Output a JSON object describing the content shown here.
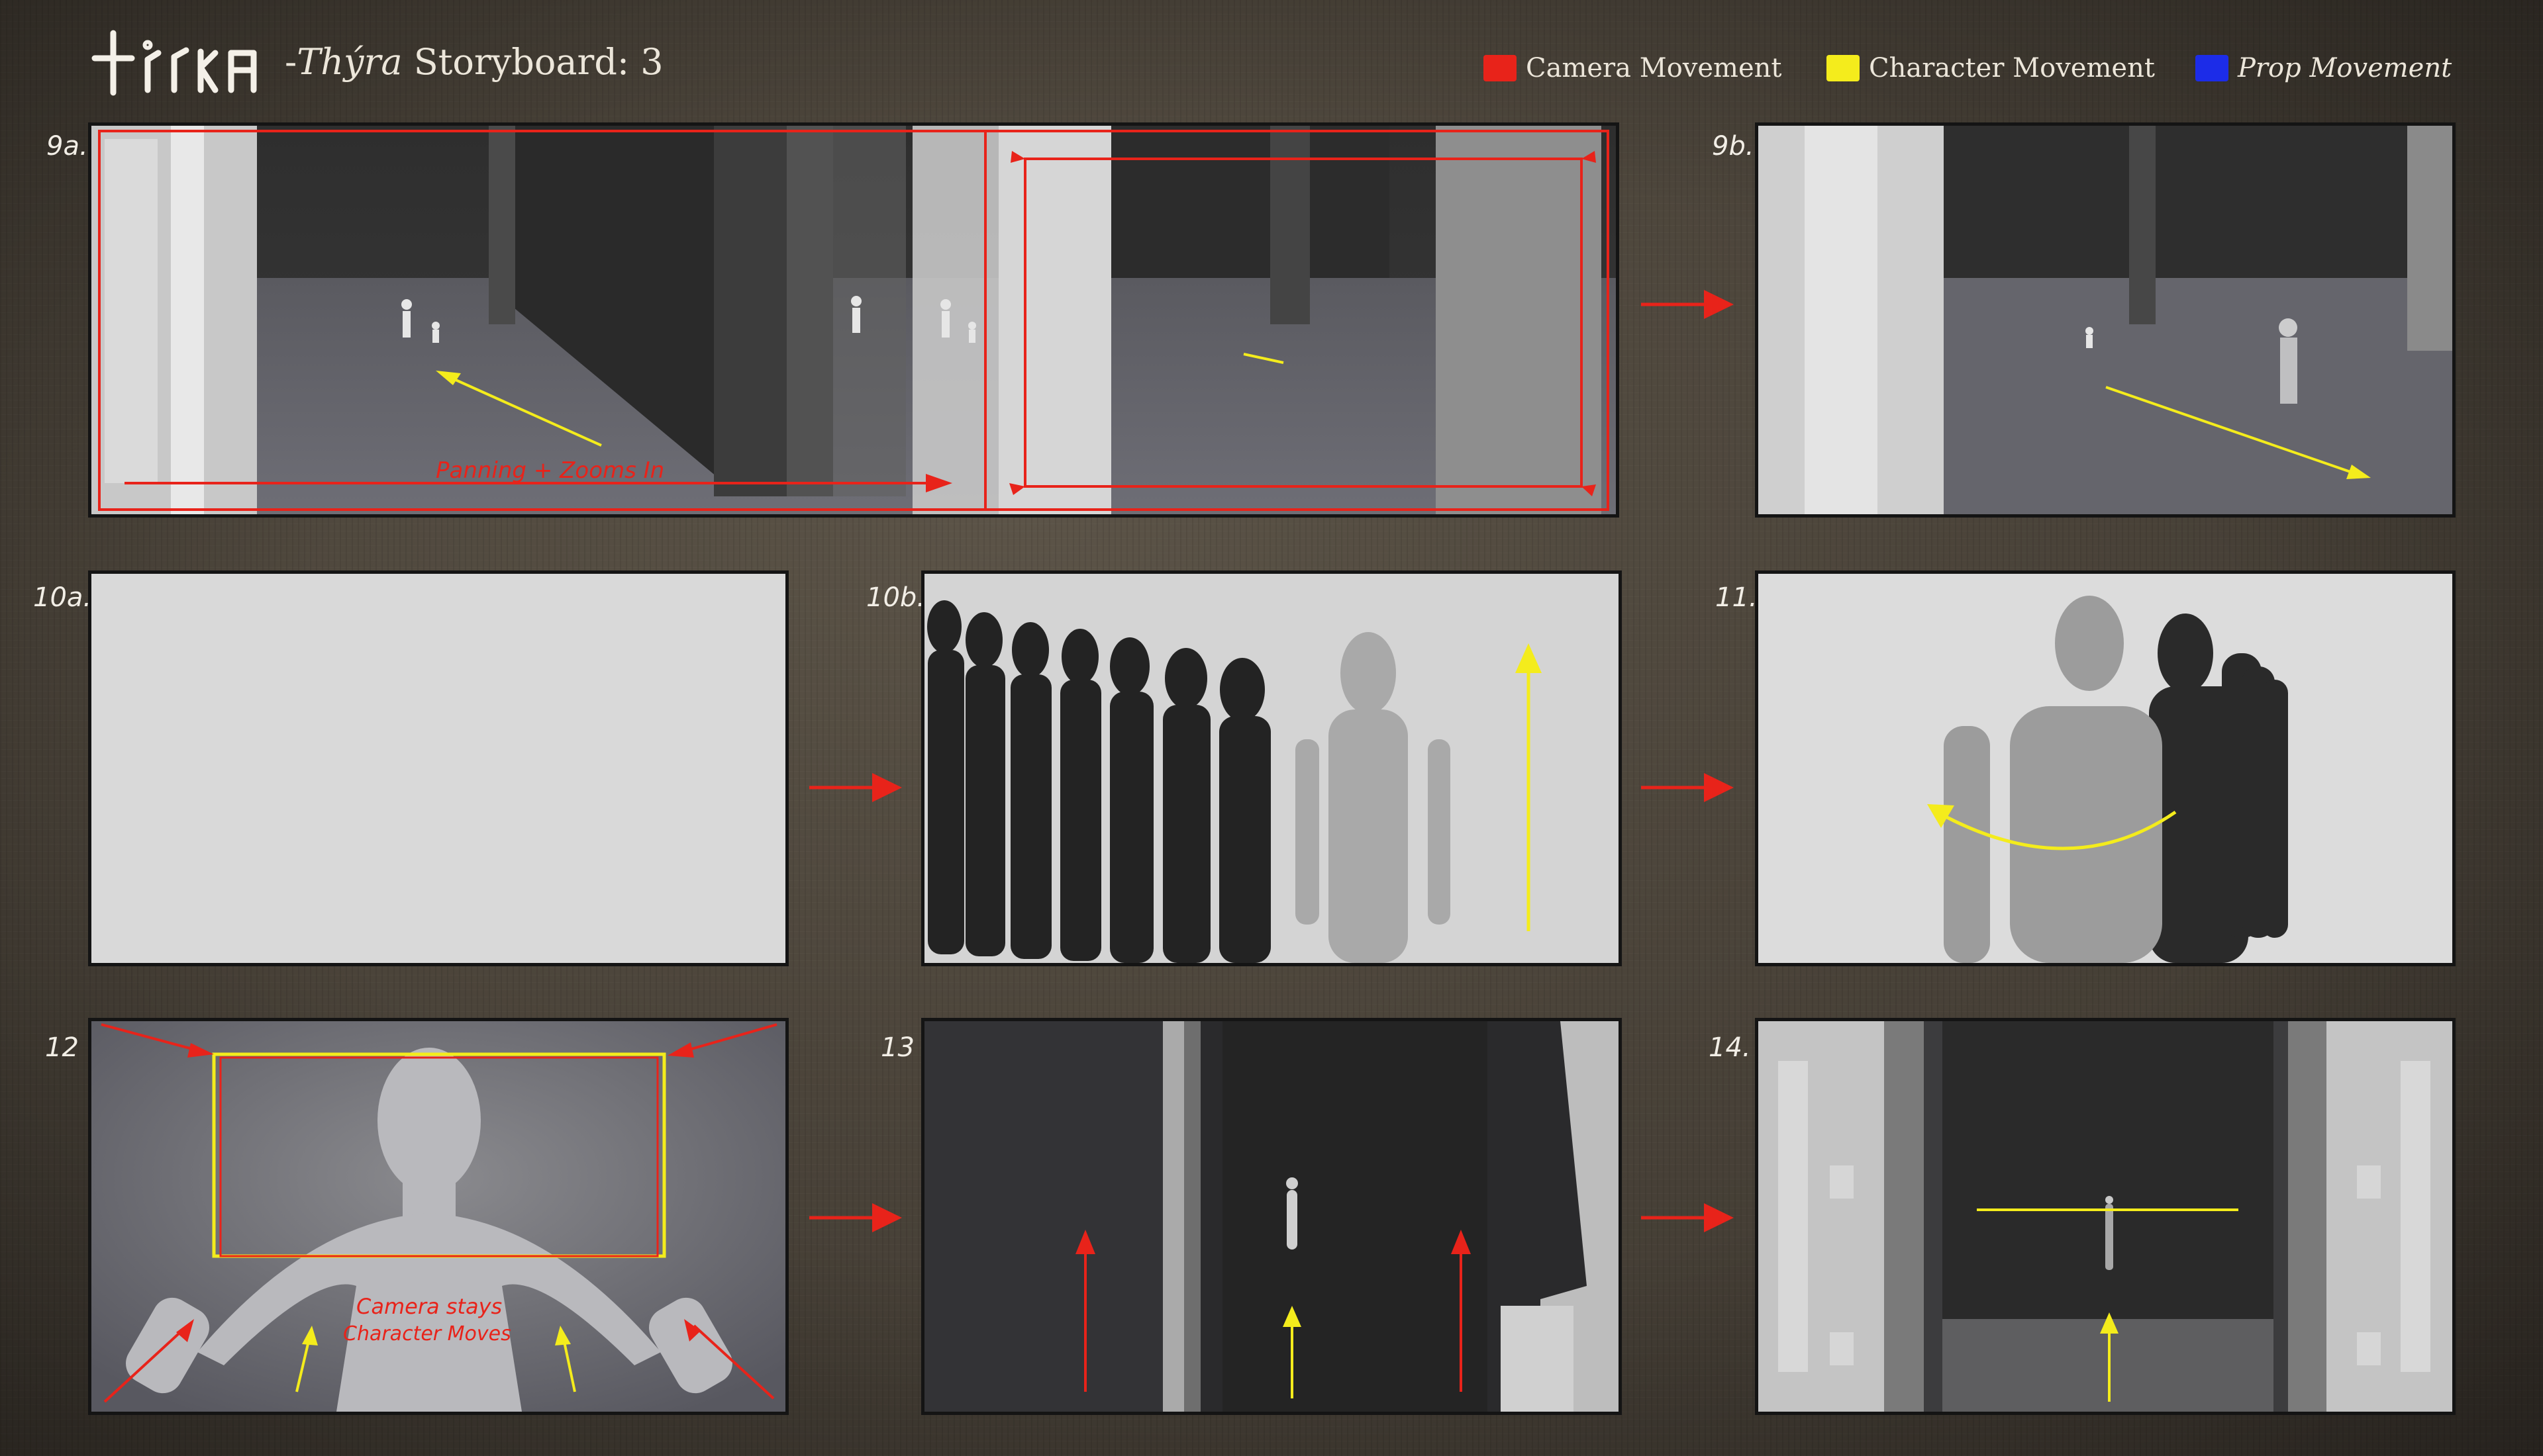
{
  "header": {
    "title_dash": "-",
    "title_name": "Thýra",
    "title_rest": " Storyboard: 3"
  },
  "legend": [
    {
      "label": "Camera Movement",
      "color": "#e8231a"
    },
    {
      "label": "Character Movement",
      "color": "#f4ec1c"
    },
    {
      "label": "Prop Movement",
      "color": "#1c2ce8"
    }
  ],
  "panels": [
    {
      "label": "9a."
    },
    {
      "label": "9b."
    },
    {
      "label": "10a."
    },
    {
      "label": "10b."
    },
    {
      "label": "11."
    },
    {
      "label": "12"
    },
    {
      "label": "13"
    },
    {
      "label": "14."
    }
  ],
  "annotations": {
    "panning_zoom": "Panning + Zooms In",
    "camera_stays": "Camera stays",
    "character_moves": "Character Moves"
  },
  "colors": {
    "camera": "#e8231a",
    "character": "#f4ec1c",
    "prop": "#1c2ce8"
  }
}
